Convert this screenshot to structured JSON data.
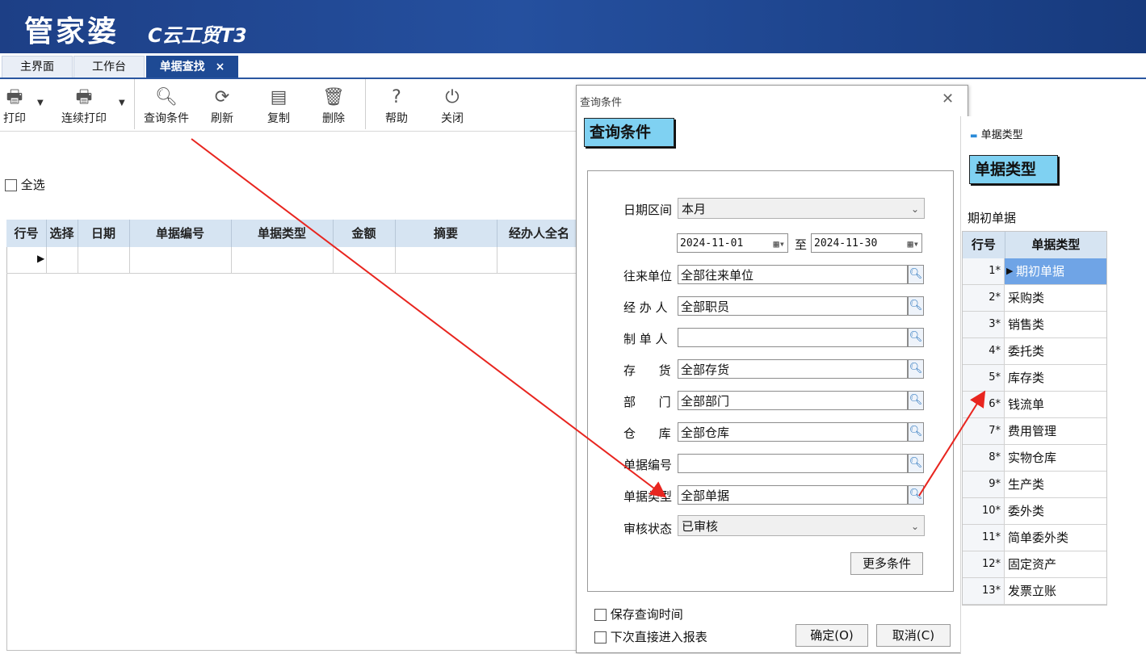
{
  "app": {
    "logo": "管家婆",
    "product": "C云工贸T3"
  },
  "tabs": [
    {
      "label": "主界面"
    },
    {
      "label": "工作台"
    },
    {
      "label": "单据查找",
      "close": "×"
    }
  ],
  "toolbar": {
    "print": "打印",
    "continuous_print": "连续打印",
    "query": "查询条件",
    "refresh": "刷新",
    "copy": "复制",
    "delete": "删除",
    "help": "帮助",
    "close": "关闭"
  },
  "select_all": "全选",
  "table": {
    "columns": [
      "行号",
      "选择",
      "日期",
      "单据编号",
      "单据类型",
      "金额",
      "摘要",
      "经办人全名"
    ]
  },
  "dialog": {
    "window_title": "查询条件",
    "heading": "查询条件",
    "date_range_label": "日期区间",
    "date_range_value": "本月",
    "date_from": "2024-11-01",
    "date_to_sep": "至",
    "date_to": "2024-11-30",
    "fields": [
      {
        "label": "往来单位",
        "value": "全部往来单位"
      },
      {
        "label": "经 办 人",
        "value": "全部职员"
      },
      {
        "label": "制 单 人",
        "value": ""
      },
      {
        "label": "存      货",
        "value": "全部存货"
      },
      {
        "label": "部      门",
        "value": "全部部门"
      },
      {
        "label": "仓      库",
        "value": "全部仓库"
      },
      {
        "label": "单据编号",
        "value": ""
      },
      {
        "label": "单据类型",
        "value": "全部单据"
      }
    ],
    "audit_label": "审核状态",
    "audit_value": "已审核",
    "more": "更多条件",
    "save_time": "保存查询时间",
    "direct_report": "下次直接进入报表",
    "ok": "确定(O)",
    "cancel": "取消(C)"
  },
  "side_panel": {
    "window_title": "单据类型",
    "heading": "单据类型",
    "current": "期初单据",
    "col_row": "行号",
    "col_type": "单据类型",
    "rows": [
      {
        "n": "1*",
        "t": "期初单据"
      },
      {
        "n": "2*",
        "t": "采购类"
      },
      {
        "n": "3*",
        "t": "销售类"
      },
      {
        "n": "4*",
        "t": "委托类"
      },
      {
        "n": "5*",
        "t": "库存类"
      },
      {
        "n": "6*",
        "t": "钱流单"
      },
      {
        "n": "7*",
        "t": "费用管理"
      },
      {
        "n": "8*",
        "t": "实物仓库"
      },
      {
        "n": "9*",
        "t": "生产类"
      },
      {
        "n": "10*",
        "t": "委外类"
      },
      {
        "n": "11*",
        "t": "简单委外类"
      },
      {
        "n": "12*",
        "t": "固定资产"
      },
      {
        "n": "13*",
        "t": "发票立账"
      }
    ]
  }
}
